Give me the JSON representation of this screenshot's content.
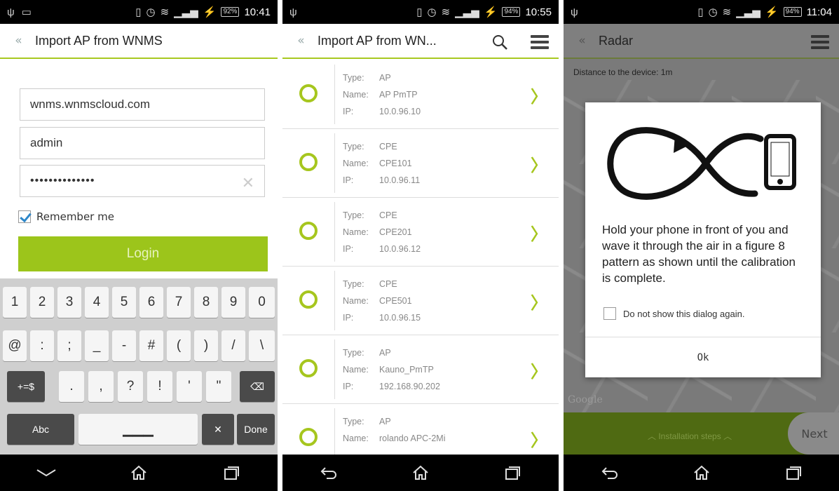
{
  "status_bars": [
    {
      "battery": "92%",
      "time": "10:41"
    },
    {
      "battery": "94%",
      "time": "10:55"
    },
    {
      "battery": "94%",
      "time": "11:04"
    }
  ],
  "login_screen": {
    "title": "Import AP from WNMS",
    "back_glyph": "«",
    "server_value": "wnms.wnmscloud.com",
    "username_value": "admin",
    "password_value": "••••••••••••••",
    "remember_label": "Remember me",
    "remember_checked": true,
    "login_label": "Login",
    "keyboard": {
      "row1": [
        "1",
        "2",
        "3",
        "4",
        "5",
        "6",
        "7",
        "8",
        "9",
        "0"
      ],
      "row2": [
        "@",
        ":",
        ";",
        "_",
        "-",
        "#",
        "(",
        ")",
        "/",
        "\\"
      ],
      "row3": [
        "+=$",
        ".",
        ",",
        "?",
        "!",
        "'",
        "\""
      ],
      "abc": "Abc",
      "done": "Done"
    }
  },
  "list_screen": {
    "title": "Import AP from WN...",
    "back_glyph": "«",
    "labels": {
      "type": "Type:",
      "name": "Name:",
      "ip": "IP:"
    },
    "items": [
      {
        "type": "AP",
        "name": "AP PmTP",
        "ip": "10.0.96.10"
      },
      {
        "type": "CPE",
        "name": "CPE101",
        "ip": "10.0.96.11"
      },
      {
        "type": "CPE",
        "name": "CPE201",
        "ip": "10.0.96.12"
      },
      {
        "type": "CPE",
        "name": "CPE501",
        "ip": "10.0.96.15"
      },
      {
        "type": "AP",
        "name": "Kauno_PmTP",
        "ip": "192.168.90.202"
      },
      {
        "type": "AP",
        "name": "rolando APC-2Mi",
        "ip": ""
      }
    ]
  },
  "radar_screen": {
    "title": "Radar",
    "back_glyph": "«",
    "distance": "Distance to the device: 1m",
    "map_attribution": "Google",
    "installation_steps": "Installation steps",
    "next_label": "Next",
    "dialog": {
      "text": "Hold your phone in front of you and wave it through the air in a figure 8 pattern as shown until the calibration is complete.",
      "dont_show": "Do not show this dialog again.",
      "ok": "Ok"
    }
  },
  "colors": {
    "accent": "#9cc51b",
    "ring": "#a6c61e"
  }
}
